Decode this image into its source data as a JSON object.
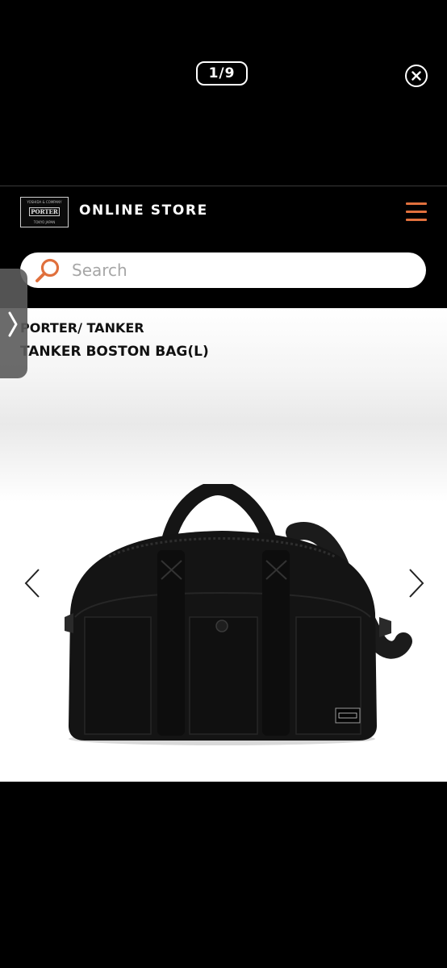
{
  "viewer": {
    "page_counter": "1/9",
    "close_icon": "close-icon"
  },
  "store": {
    "logo_text": "PORTER",
    "logo_top": "YOSHIDA & COMPANY",
    "logo_bottom": "TOKYO JAPAN",
    "title": "ONLINE STORE",
    "menu_icon": "hamburger-menu-icon",
    "accent_color": "#e0703d"
  },
  "search": {
    "placeholder": "Search",
    "icon": "search-icon"
  },
  "product": {
    "brand": "PORTER/ TANKER",
    "name": "TANKER BOSTON BAG(L)",
    "image": "black-boston-bag",
    "prev_icon": "chevron-left-icon",
    "next_icon": "chevron-right-icon"
  },
  "side_tab": {
    "icon": "chevron-right-icon"
  }
}
